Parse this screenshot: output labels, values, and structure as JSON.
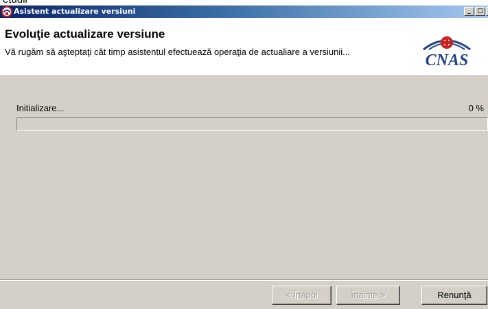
{
  "background_fragment": "etudii",
  "window": {
    "title": "Asistent actualizare versiuni",
    "controls": {
      "minimize": "_",
      "maximize": "□"
    }
  },
  "header": {
    "title": "Evoluţie actualizare versiune",
    "subtitle": "Vă rugăm să aşteptaţi cât timp asistentul efectuează operaţia de actualiare a versiunii...",
    "logo_text": "CNAS"
  },
  "progress": {
    "status_label": "Initializare...",
    "percent_label": "0 %",
    "value": 0
  },
  "buttons": {
    "back": "< Înapoi",
    "next": "Înainte >",
    "cancel": "Renunţă"
  },
  "colors": {
    "titlebar_start": "#0a246a",
    "titlebar_end": "#a6caf0",
    "window_bg": "#d4d0c8",
    "logo_blue": "#1f3f8c",
    "logo_red": "#cc1f1f"
  }
}
